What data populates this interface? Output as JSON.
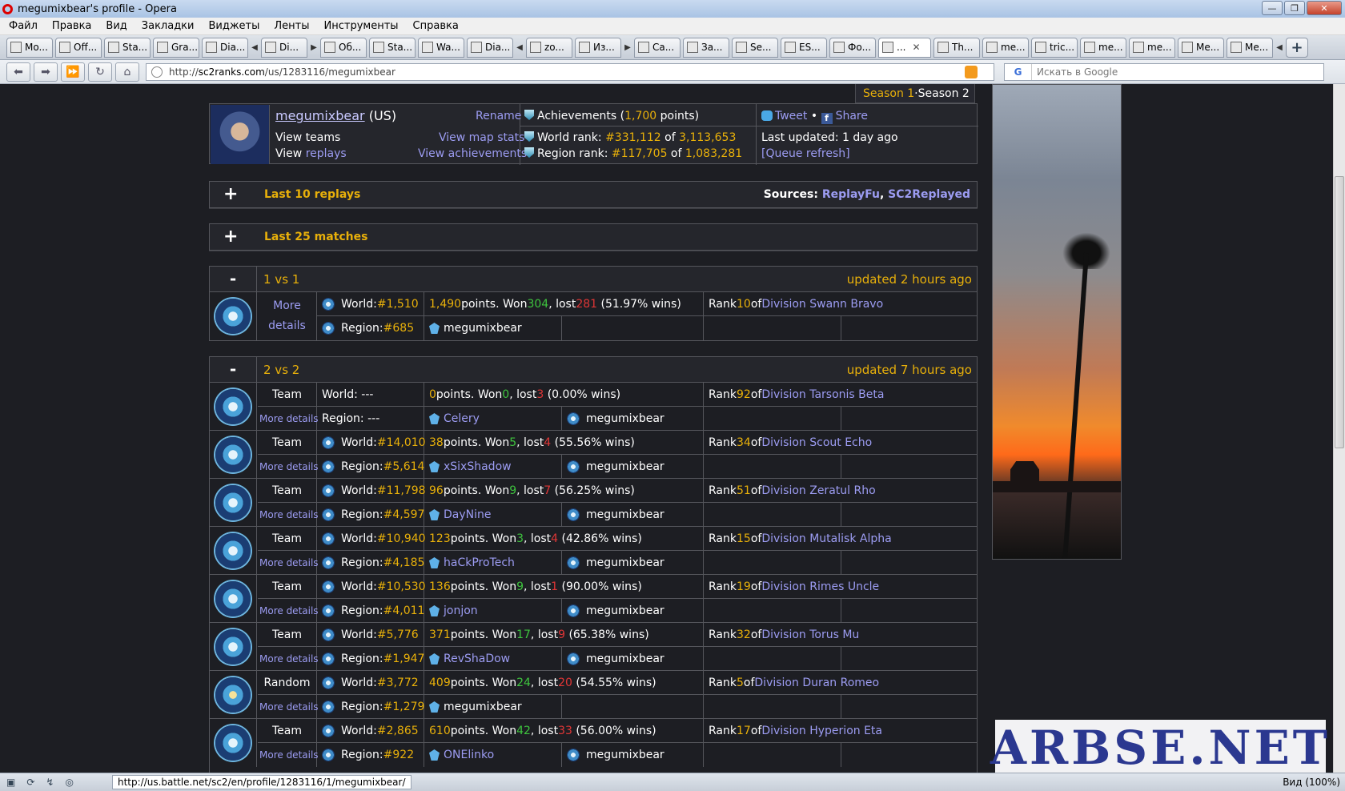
{
  "window": {
    "title": "megumixbear's profile - Opera",
    "menu": [
      "Файл",
      "Правка",
      "Вид",
      "Закладки",
      "Виджеты",
      "Ленты",
      "Инструменты",
      "Справка"
    ]
  },
  "tabs": [
    "Mo...",
    "Off...",
    "Sta...",
    "Gra...",
    "Dia...",
    "Di...",
    "Об...",
    "Sta...",
    "Wa...",
    "Dia...",
    "zo...",
    "Из...",
    "Ca...",
    "За...",
    "Se...",
    "ES...",
    "Фо...",
    "...",
    "Th...",
    "me...",
    "tric...",
    "me...",
    "me...",
    "Me...",
    "Me..."
  ],
  "address": {
    "url_prefix": "http://",
    "url_domain": "sc2ranks.com",
    "url_path": "/us/1283116/megumixbear",
    "search_placeholder": "Искать в Google",
    "search_engine": "G"
  },
  "status": {
    "url": "http://us.battle.net/sc2/en/profile/1283116/1/megumixbear/",
    "zoom": "Вид (100%)"
  },
  "season": {
    "s1": "Season 1",
    "sep": " · ",
    "s2": "Season 2"
  },
  "profile": {
    "name": "megumixbear",
    "region": "(US)",
    "rename": "Rename",
    "view_teams": "View teams",
    "view": "View",
    "replays": "replays",
    "view_map_stats": "View map stats",
    "view_achievements": "View achievements",
    "achievements_label": "Achievements (",
    "achievements_points": "1,700",
    "achievements_suffix": " points)",
    "world_rank_label": "World rank: ",
    "world_rank": "#331,112",
    "of": " of ",
    "world_total": "3,113,653",
    "region_rank_label": "Region rank: ",
    "region_rank": "#117,705",
    "region_total": "1,083,281",
    "tweet": "Tweet",
    "bullet": " • ",
    "share": "Share",
    "last_updated": "Last updated: 1 day ago",
    "queue_refresh": "[Queue refresh]"
  },
  "replays_bar": {
    "toggle": "+",
    "label": "Last 10 replays",
    "sources_label": "Sources: ",
    "source1": "ReplayFu",
    "comma": ", ",
    "source2": "SC2Replayed"
  },
  "matches_bar": {
    "toggle": "+",
    "label": "Last 25 matches"
  },
  "ladder_1v1": {
    "toggle": "-",
    "name": "1 vs 1",
    "updated": "updated 2 hours ago",
    "more": "More",
    "details": "details",
    "world_label": "World: ",
    "world": "#1,510",
    "region_label": "Region: ",
    "region": "#685",
    "points": "1,490",
    "won": "304",
    "lost": "281",
    "pct": "(51.97% wins)",
    "rank": "10",
    "division": "Division Swann Bravo",
    "player": "megumixbear"
  },
  "ladder_2v2": {
    "toggle": "-",
    "name": "2 vs 2",
    "updated": "updated 7 hours ago",
    "more_details": "More details",
    "rows": [
      {
        "type": "Team",
        "world_label": "World: ---",
        "world": "",
        "region_label": "Region: ---",
        "region": "",
        "points": "0",
        "won": "0",
        "lost": "3",
        "pct": "(0.00% wins)",
        "rank": "92",
        "division": "Division Tarsonis Beta",
        "partner": "Celery",
        "self": "megumixbear"
      },
      {
        "type": "Team",
        "world_label": "World: ",
        "world": "#14,010",
        "region_label": "Region: ",
        "region": "#5,614",
        "points": "38",
        "won": "5",
        "lost": "4",
        "pct": "(55.56% wins)",
        "rank": "34",
        "division": "Division Scout Echo",
        "partner": "xSixShadow",
        "self": "megumixbear"
      },
      {
        "type": "Team",
        "world_label": "World: ",
        "world": "#11,798",
        "region_label": "Region: ",
        "region": "#4,597",
        "points": "96",
        "won": "9",
        "lost": "7",
        "pct": "(56.25% wins)",
        "rank": "51",
        "division": "Division Zeratul Rho",
        "partner": "DayNine",
        "self": "megumixbear"
      },
      {
        "type": "Team",
        "world_label": "World: ",
        "world": "#10,940",
        "region_label": "Region: ",
        "region": "#4,185",
        "points": "123",
        "won": "3",
        "lost": "4",
        "pct": "(42.86% wins)",
        "rank": "15",
        "division": "Division Mutalisk Alpha",
        "partner": "haCkProTech",
        "self": "megumixbear"
      },
      {
        "type": "Team",
        "world_label": "World: ",
        "world": "#10,530",
        "region_label": "Region: ",
        "region": "#4,011",
        "points": "136",
        "won": "9",
        "lost": "1",
        "pct": "(90.00% wins)",
        "rank": "19",
        "division": "Division Rimes Uncle",
        "partner": "jonjon",
        "self": "megumixbear"
      },
      {
        "type": "Team",
        "world_label": "World: ",
        "world": "#5,776",
        "region_label": "Region: ",
        "region": "#1,947",
        "points": "371",
        "won": "17",
        "lost": "9",
        "pct": "(65.38% wins)",
        "rank": "32",
        "division": "Division Torus Mu",
        "partner": "RevShaDow",
        "self": "megumixbear"
      },
      {
        "type": "Random",
        "world_label": "World: ",
        "world": "#3,772",
        "region_label": "Region: ",
        "region": "#1,279",
        "points": "409",
        "won": "24",
        "lost": "20",
        "pct": "(54.55% wins)",
        "rank": "5",
        "division": "Division Duran Romeo",
        "partner": "megumixbear",
        "self": ""
      },
      {
        "type": "Team",
        "world_label": "World: ",
        "world": "#2,865",
        "region_label": "Region: ",
        "region": "#922",
        "points": "610",
        "won": "42",
        "lost": "33",
        "pct": "(56.00% wins)",
        "rank": "17",
        "division": "Division Hyperion Eta",
        "partner": "ONElinko",
        "self": "megumixbear"
      }
    ]
  },
  "words": {
    "points": " points. Won ",
    "lost": ", lost ",
    "rank": "Rank ",
    "of": " of "
  },
  "watermark": "ARBSE.NET",
  "colors": {
    "accent": "#e8b00a",
    "won": "#3ec43e",
    "lost": "#e03636",
    "link": "#9c9cf2",
    "bg": "#1d1e23"
  }
}
